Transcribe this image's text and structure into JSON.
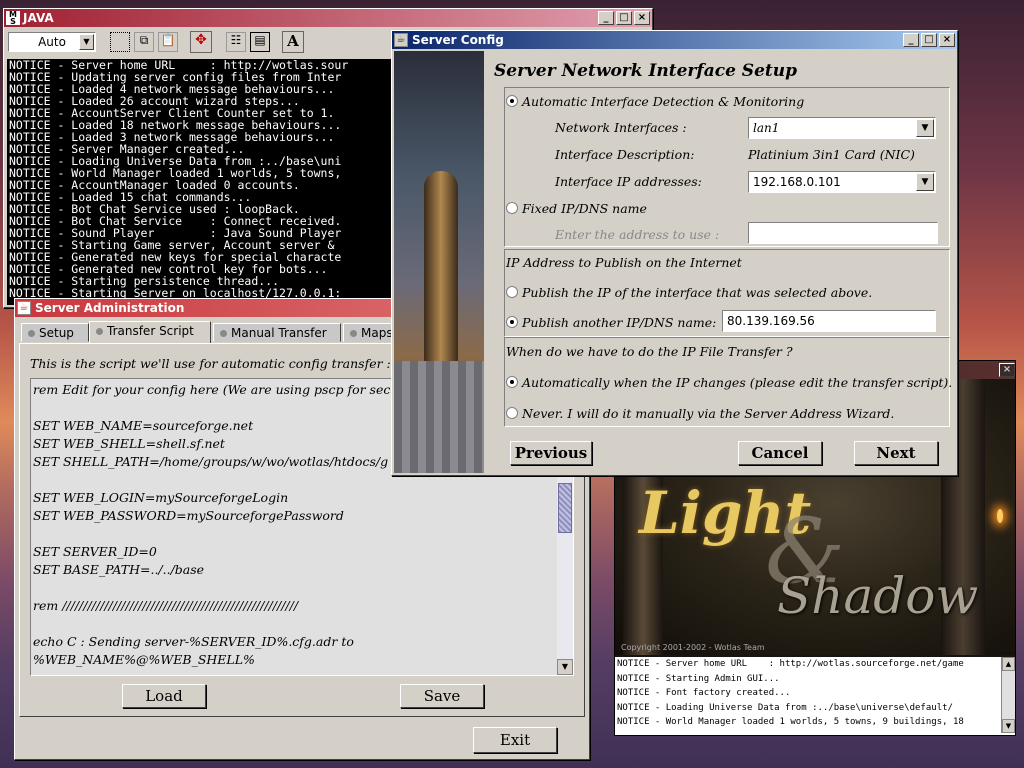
{
  "java_window": {
    "title": "JAVA",
    "font_select": "Auto",
    "console_lines": [
      "NOTICE - Server home URL     : http://wotlas.sour",
      "NOTICE - Updating server config files from Inter",
      "NOTICE - Loaded 4 network message behaviours...",
      "NOTICE - Loaded 26 account wizard steps...",
      "NOTICE - AccountServer Client Counter set to 1.",
      "NOTICE - Loaded 18 network message behaviours...",
      "NOTICE - Loaded 3 network message behaviours...",
      "NOTICE - Server Manager created...",
      "NOTICE - Loading Universe Data from :../base\\uni",
      "NOTICE - World Manager loaded 1 worlds, 5 towns,",
      "NOTICE - AccountManager loaded 0 accounts.",
      "NOTICE - Loaded 15 chat commands...",
      "NOTICE - Bot Chat Service used : loopBack.",
      "NOTICE - Bot Chat Service    : Connect received.",
      "NOTICE - Sound Player        : Java Sound Player",
      "NOTICE - Starting Game server, Account server &",
      "NOTICE - Generated new keys for special characte",
      "NOTICE - Generated new control key for bots...",
      "NOTICE - Starting persistence thread...",
      "NOTICE - Starting Server on localhost/127.0.0.1:"
    ]
  },
  "server_admin": {
    "title": "Server Administration",
    "tabs": [
      {
        "label": "Setup"
      },
      {
        "label": "Transfer Script"
      },
      {
        "label": "Manual Transfer"
      },
      {
        "label": "Maps"
      }
    ],
    "intro": "This is the script we'll use for automatic config transfer :",
    "script_lines": [
      "rem Edit for your config here (We are using pscp for secur",
      "",
      "SET WEB_NAME=sourceforge.net",
      "SET WEB_SHELL=shell.sf.net",
      "SET SHELL_PATH=/home/groups/w/wo/wotlas/htdocs/g",
      "",
      "SET WEB_LOGIN=mySourceforgeLogin",
      "SET WEB_PASSWORD=mySourceforgePassword",
      "",
      "SET SERVER_ID=0",
      "SET BASE_PATH=../../base",
      "",
      "rem ////////////////////////////////////////////////////////",
      "",
      "echo C : Sending server-%SERVER_ID%.cfg.adr to",
      "%WEB_NAME%@%WEB_SHELL%"
    ],
    "load_label": "Load",
    "save_label": "Save",
    "exit_label": "Exit"
  },
  "server_config": {
    "title": "Server Config",
    "heading": "Server Network Interface Setup",
    "auto_detect_label": "Automatic Interface Detection & Monitoring",
    "net_if_label": "Network Interfaces :",
    "net_if_value": "lan1",
    "if_desc_label": "Interface Description:",
    "if_desc_value": "Platinium 3in1 Card (NIC)",
    "if_ip_label": "Interface IP addresses:",
    "if_ip_value": "192.168.0.101",
    "fixed_label": "Fixed IP/DNS name",
    "enter_addr_label": "Enter the address to use :",
    "enter_addr_value": "",
    "publish_section": "IP Address to Publish on the Internet",
    "publish_iface_label": "Publish the IP of the interface that was selected above.",
    "publish_other_label": "Publish another IP/DNS name:",
    "publish_other_value": "80.139.169.56",
    "transfer_section": "When do we have to do the IP File Transfer ?",
    "auto_change_label": "Automatically when the IP changes (please edit the transfer script).",
    "never_label": "Never. I will do it manually via the Server Address Wizard.",
    "previous_label": "Previous",
    "cancel_label": "Cancel",
    "next_label": "Next"
  },
  "splash": {
    "logo_light": "Light",
    "logo_amp": "&",
    "logo_shadow": "Shadow",
    "copyright": "Copyright  2001-2002  - Wotlas Team",
    "log_lines": [
      "NOTICE - Server home URL    : http://wotlas.sourceforge.net/game",
      "NOTICE - Starting Admin GUI...",
      "NOTICE - Font factory created...",
      "NOTICE - Loading Universe Data from :../base\\universe\\default/",
      "NOTICE - World Manager loaded 1 worlds, 5 towns, 9 buildings, 18"
    ]
  },
  "colors": {
    "titlebar_active": "#0a246a",
    "titlebar_active2": "#a6caf0",
    "titlebar_inactive": "#c0404a",
    "face": "#d4d0c8"
  }
}
